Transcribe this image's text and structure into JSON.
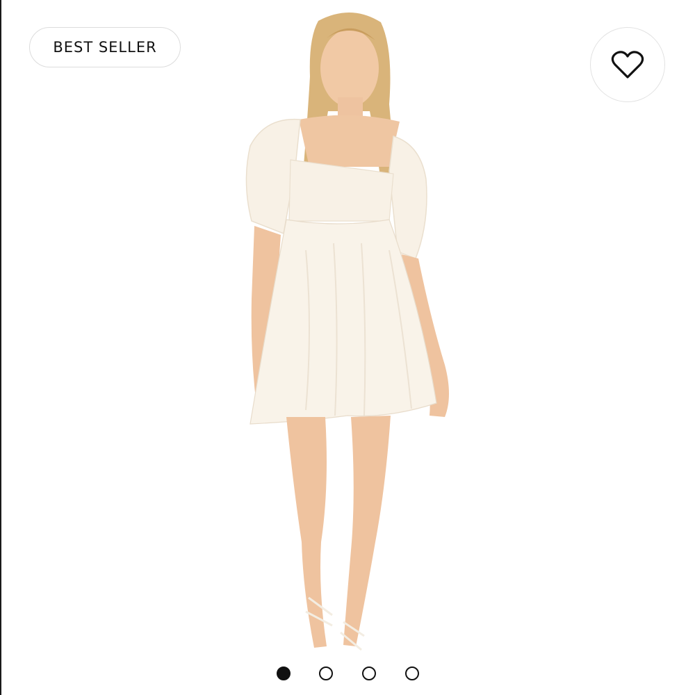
{
  "badge": {
    "label": "BEST SELLER"
  },
  "favorite": {
    "icon": "heart-icon",
    "active": false
  },
  "carousel": {
    "total": 4,
    "current": 1,
    "dot_color": "#111111"
  },
  "product_image": {
    "dress_color": "#f8f1e6",
    "skin_color": "#f0c9a6",
    "hair_color": "#d9b47a"
  }
}
